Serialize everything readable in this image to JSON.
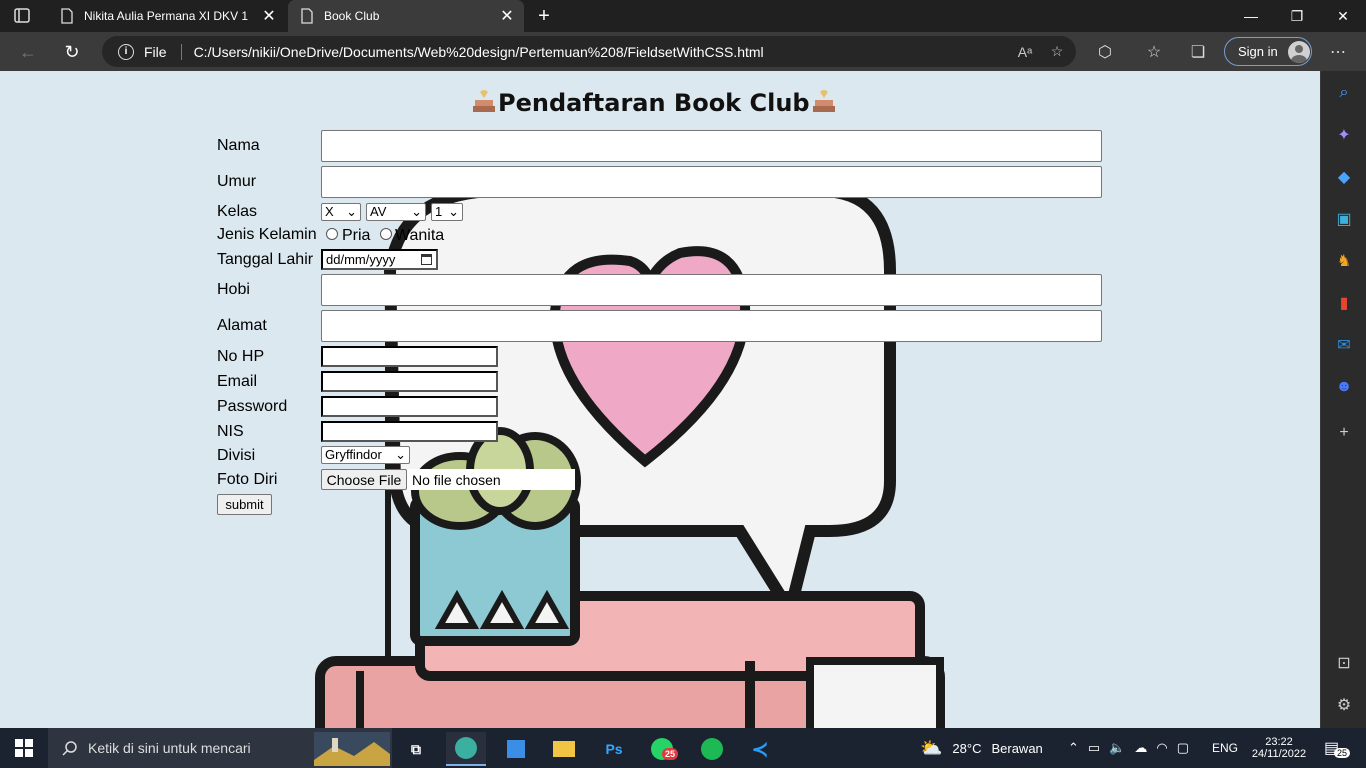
{
  "browser": {
    "tabs": [
      {
        "title": "Nikita Aulia Permana XI DKV 1",
        "active": false
      },
      {
        "title": "Book Club",
        "active": true
      }
    ],
    "url_scheme": "File",
    "url": "C:/Users/nikii/OneDrive/Documents/Web%20design/Pertemuan%208/FieldsetWithCSS.html",
    "signin_label": "Sign in",
    "accent_color": "#7a9bd6"
  },
  "page": {
    "heading": "Pendaftaran Book Club",
    "background_color": "#dbe8ef",
    "labels": {
      "nama": "Nama",
      "umur": "Umur",
      "kelas": "Kelas",
      "jenis_kelamin": "Jenis Kelamin",
      "tanggal_lahir": "Tanggal Lahir",
      "hobi": "Hobi",
      "alamat": "Alamat",
      "no_hp": "No HP",
      "email": "Email",
      "password": "Password",
      "nis": "NIS",
      "divisi": "Divisi",
      "foto_diri": "Foto Diri"
    },
    "kelas_selects": {
      "grade": "X",
      "jurusan": "AV",
      "nomor": "1"
    },
    "gender_options": {
      "pria": "Pria",
      "wanita": "Wanita"
    },
    "date_placeholder": "dd/mm/yyyy",
    "divisi_selected": "Gryffindor",
    "file_button": "Choose File",
    "file_status": "No file chosen",
    "submit_label": "submit"
  },
  "taskbar": {
    "search_placeholder": "Ketik di sini untuk mencari",
    "weather_temp": "28°C",
    "weather_desc": "Berawan",
    "language": "ENG",
    "time": "23:22",
    "date": "24/11/2022",
    "notification_count": "25",
    "whatsapp_badge": "25"
  }
}
